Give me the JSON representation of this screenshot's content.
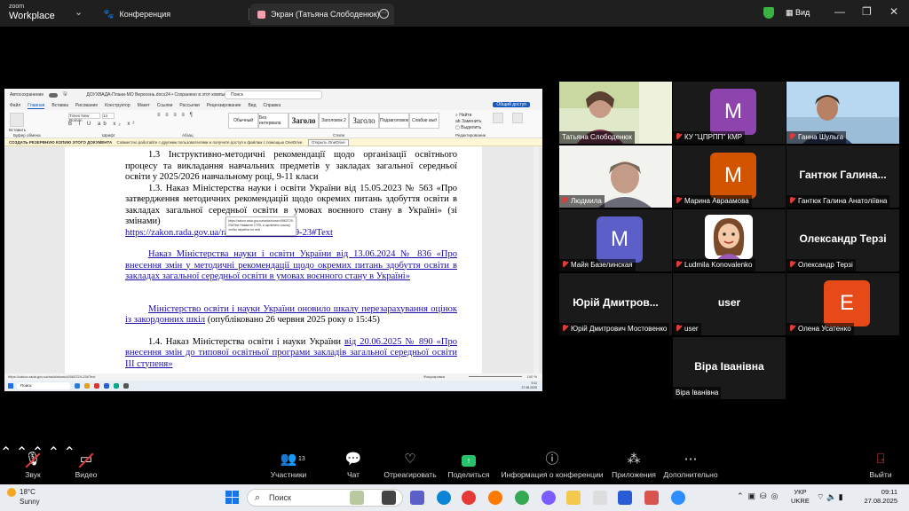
{
  "titlebar": {
    "logo_top": "zoom",
    "logo_bottom": "Workplace",
    "tab_conference": "Конференция",
    "tab_screen": "Экран (Татьяна Слободенюк)",
    "view_label": "Вид"
  },
  "shared": {
    "window_title": "ДОУХВАДА-Плани-МО Вересень.docx24 • Сохранено в этот компьютер",
    "autosave": "Автосохранение",
    "search_placeholder": "Поиск",
    "menu": [
      "Файл",
      "Главная",
      "Вставка",
      "Рисование",
      "Конструктор",
      "Макет",
      "Ссылки",
      "Рассылки",
      "Рецензирование",
      "Вид",
      "Справка"
    ],
    "share_label": "Общий доступ",
    "font_name": "Times New Roman",
    "font_size": "14",
    "styles": [
      "Обычный",
      "Без интервала",
      "Заголо",
      "Заголовок 2",
      "Заголо",
      "Подзаголовок",
      "Слабое выд"
    ],
    "ribbon_groups": [
      "Буфер обмена",
      "Шрифт",
      "Абзац",
      "Стили",
      "Редактирование"
    ],
    "paste_label": "Вставить",
    "notice_bold": "СОЗДАТЬ РЕЗЕРВНУЮ КОПИЮ ЭТОГО ДОКУМЕНТА",
    "notice_text": "Совместно работайте с другими пользователями и получите доступ к файлам с помощью OneDrive.",
    "notice_button": "Открыть OneDrive",
    "doc": {
      "p1": "1.3 Інструктивно-методичні рекомендації щодо організації освітнього процесу та викладання навчальних предметів у закладах загальної середньої освіти у 2025/2026 навчальному році, 9-11 класи",
      "p2": "1.3. Наказ Міністерства науки і освіти України від 15.05.2023 № 563 «Про затвердження методичних рекомендацій щодо окремих питань здобуття освіти в закладах загальної середньої освіти в умовах воєнного стану в Україні» (зі змінами)",
      "p3": "https://zakon.rada.gov.ua/rada/show/v0563729-23#Text",
      "p4": "Наказ Міністерства науки і освіти України від 13.06.2024 № 836 «Про внесення змін у методичні рекомендації щодо окремих питань здобуття освіти в закладах загальної середньої освіти в умовах воєнного стану в Україні»",
      "p5_link": "Міністерство освіти і науки України оновило шкалу перезарахування оцінок із закордонних шкіл",
      "p5_rest": " (опубліковано 26 червня 2025 року о 15:45)",
      "p6_a": "1.4. Наказ Міністерства освіти і науки України ",
      "p6_link": "від 20.06.2025 № 890 «Про внесення змін до типової освітньої програми закладів загальної середньої освіти ІІІ ступеня»"
    },
    "tooltip": "https://zakon.rada.gov.ua/rada/show/v0563729-23#Text Нажмите CTRL и щелкните ссылку, чтобы перейти по ней",
    "status_left": "https://zakon.rada.gov.ua/rada/show/v0563729-23#Text",
    "status_right": "Фокусировка",
    "zoom": "100 %",
    "taskbar_search": "Поиск",
    "time": "9:11",
    "date": "27.08.2025"
  },
  "participants": [
    {
      "name": "Татьяна Слободенюк",
      "type": "photo",
      "muted": false,
      "selected": true
    },
    {
      "name": "КУ \"ЦПРПП\" КМР",
      "type": "avatar",
      "letter": "M",
      "color": "#8e44ad",
      "muted": true
    },
    {
      "name": "Ганна Шульга",
      "type": "photo",
      "muted": true
    },
    {
      "name": "Людмила",
      "type": "photo",
      "muted": true
    },
    {
      "name": "Марина Авраамова",
      "type": "avatar",
      "letter": "M",
      "color": "#d35400",
      "muted": true
    },
    {
      "name": "Гантюк Галина Анатоліївна",
      "type": "text",
      "big": "Гантюк Галина...",
      "muted": true
    },
    {
      "name": "Майя Базелинская",
      "type": "avatar",
      "letter": "M",
      "color": "#5b5fc7",
      "muted": true
    },
    {
      "name": "Ludmila Konovalenko",
      "type": "cartoon",
      "muted": true
    },
    {
      "name": "Олександр Терзі",
      "type": "text",
      "big": "Олександр Терзі",
      "muted": true
    },
    {
      "name": "Юрій Дмитрович Мостовенко",
      "type": "text",
      "big": "Юрій Дмитров...",
      "muted": true
    },
    {
      "name": "user",
      "type": "text",
      "big": "user",
      "muted": true
    },
    {
      "name": "Олена Усатенко",
      "type": "avatar",
      "letter": "E",
      "color": "#e64a19",
      "muted": true
    },
    {
      "name": "Віра Іванівна",
      "type": "text",
      "big": "Віра Іванівна",
      "muted": false
    }
  ],
  "toolbar": {
    "audio": "Звук",
    "video": "Видео",
    "participants": "Участники",
    "participants_count": "13",
    "chat": "Чат",
    "react": "Отреагировать",
    "share": "Поделиться",
    "info": "Информация о конференции",
    "apps": "Приложения",
    "more": "Дополнительно",
    "leave": "Выйти"
  },
  "taskbar": {
    "temp": "18°C",
    "weather": "Sunny",
    "search": "Поиск",
    "lang_top": "УКР",
    "lang_bottom": "UKRE",
    "time": "09:11",
    "date": "27.08.2025"
  },
  "colors": {
    "accent": "#2ecc71",
    "share_green": "#27c26c",
    "leave_red": "#e53935"
  }
}
